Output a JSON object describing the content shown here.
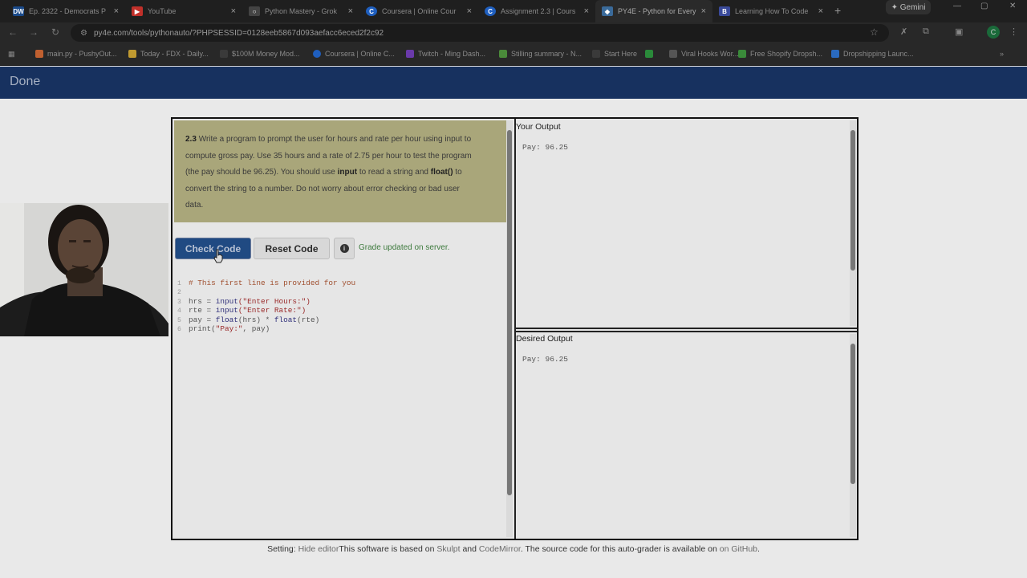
{
  "tabs": [
    {
      "title": "Ep. 2322 - Democrats P",
      "icon": "dw-icon",
      "badge": "DW",
      "color": "#1a4a8a"
    },
    {
      "title": "YouTube",
      "icon": "youtube-icon",
      "badge": "▶",
      "color": "#c0302a"
    },
    {
      "title": "Python Mastery - Grok",
      "icon": "grok-icon",
      "badge": "○",
      "color": "#444444"
    },
    {
      "title": "Coursera | Online Cour",
      "icon": "coursera-icon",
      "badge": "C",
      "color": "#1f5fbf"
    },
    {
      "title": "Assignment 2.3 | Cours",
      "icon": "coursera-icon",
      "badge": "C",
      "color": "#1f5fbf"
    },
    {
      "title": "PY4E - Python for Every",
      "icon": "python-icon",
      "badge": "◆",
      "color": "#3a6a9a"
    },
    {
      "title": "Learning How To Code",
      "icon": "doc-icon",
      "badge": "B",
      "color": "#3a4a9a"
    }
  ],
  "gemini_label": "Gemini",
  "url": "py4e.com/tools/pythonauto/?PHPSESSID=0128eeb5867d093aefacc6eced2f2c92",
  "bookmarks": [
    {
      "label": "main.py - PushyOut...",
      "color": "#c06030"
    },
    {
      "label": "Today - FDX - Daily...",
      "color": "#c09a30"
    },
    {
      "label": "$100M Money Mod...",
      "color": "#3a3a3a"
    },
    {
      "label": "Coursera | Online C...",
      "color": "#1f5fbf"
    },
    {
      "label": "Twitch - Ming Dash...",
      "color": "#6a3aaa"
    },
    {
      "label": "Stilling summary - N...",
      "color": "#4a8a3a"
    },
    {
      "label": "Start Here",
      "color": "#3a3a3a"
    },
    {
      "label": "",
      "color": "#2a8a3a"
    },
    {
      "label": "Viral Hooks Wor...",
      "color": "#555555"
    },
    {
      "label": "Free Shopify Dropsh...",
      "color": "#3a8a3a"
    },
    {
      "label": "Dropshipping Launc...",
      "color": "#2a6abf"
    }
  ],
  "header": {
    "title": "Done"
  },
  "prompt": {
    "number": "2.3",
    "line1": "Write a program to prompt the user for hours and rate per hour using input to",
    "line2": "compute gross pay. Use 35 hours and a rate of 2.75 per hour to test the program",
    "line3": "(the pay should be 96.25). You should use",
    "kw_input": "input",
    "line3b": "to read a string and",
    "kw_float": "float()",
    "line3c": "to",
    "line4": "convert the string to a number. Do not worry about error checking or bad user",
    "line5": "data."
  },
  "buttons": {
    "check": "Check Code",
    "reset": "Reset Code",
    "info": "i"
  },
  "grade_status": "Grade updated on server.",
  "code": {
    "l1": "# This first line is provided for you",
    "l3a": "hrs = ",
    "l3fn": "input",
    "l3s": "(\"Enter Hours:\")",
    "l4a": "rte = ",
    "l4fn": "input",
    "l4s": "(\"Enter Rate:\")",
    "l5a": "pay = ",
    "l5fn": "float",
    "l5b": "(hrs) * ",
    "l5fn2": "float",
    "l5c": "(rte)",
    "l6a": "print(",
    "l6s": "\"Pay:\"",
    "l6b": ", pay)"
  },
  "your_output": {
    "title": "Your Output",
    "value": "Pay: 96.25"
  },
  "desired_output": {
    "title": "Desired Output",
    "value": "Pay: 96.25"
  },
  "footer": {
    "setting": "Setting:",
    "hide": "Hide editor",
    "t1": "This software is based on",
    "skulpt": "Skulpt",
    "and": "and",
    "codemirror": "CodeMirror",
    "t2": ". The source code for this auto-grader is available on",
    "github": "on GitHub",
    "end": "."
  }
}
